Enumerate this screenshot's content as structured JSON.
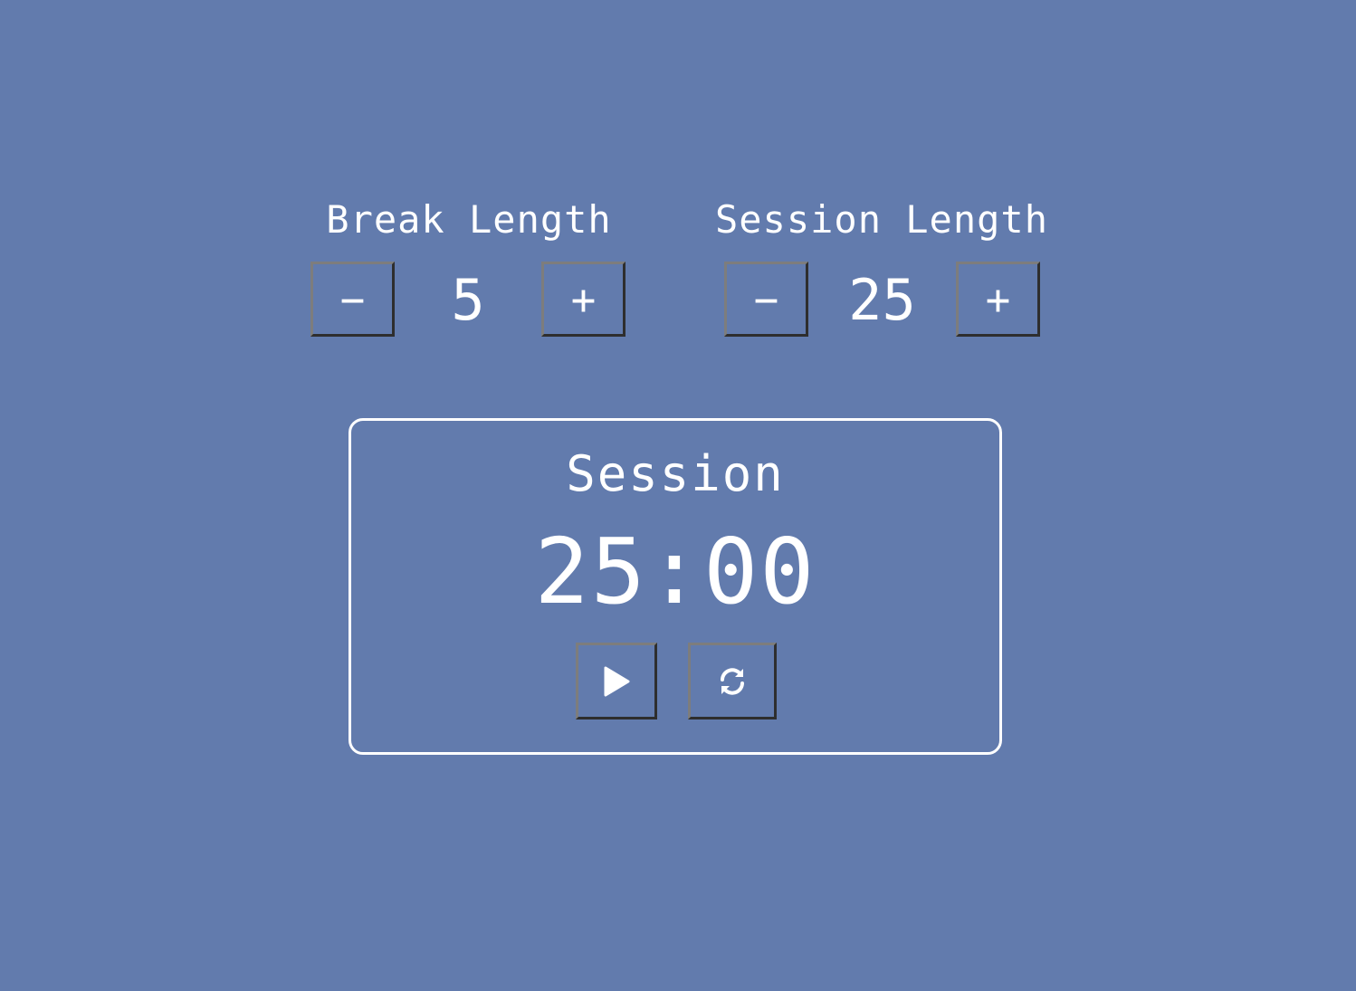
{
  "break": {
    "label": "Break Length",
    "value": "5",
    "decrement_label": "−",
    "increment_label": "+"
  },
  "session": {
    "label": "Session Length",
    "value": "25",
    "decrement_label": "−",
    "increment_label": "+"
  },
  "timer": {
    "label": "Session",
    "time": "25:00",
    "play_icon": "play-icon",
    "reset_icon": "refresh-icon"
  },
  "colors": {
    "background": "#627bad",
    "text": "#ffffff",
    "border": "#ffffff"
  }
}
